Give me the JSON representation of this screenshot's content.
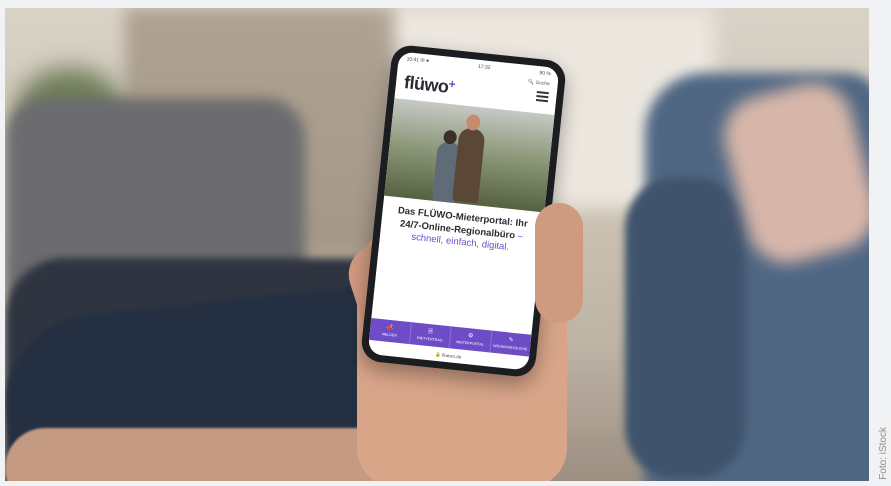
{
  "phone": {
    "status_left": "10:41 ✉ ♥",
    "status_time": "17:32",
    "status_right": "90 %",
    "search_label": "Suche",
    "logo_text": "flüwo",
    "headline_bold": "Das FLÜWO-Mieterportal: Ihr 24/7-Online-Regionalbüro",
    "headline_light": " – schnell, einfach, digital.",
    "nav": [
      {
        "icon": "megaphone-icon",
        "glyph": "📣",
        "label": "MELDEN"
      },
      {
        "icon": "document-icon",
        "glyph": "🗎",
        "label": "MIETVERTRAG"
      },
      {
        "icon": "gear-icon",
        "glyph": "⚙",
        "label": "MIETERPORTAL"
      },
      {
        "icon": "pen-icon",
        "glyph": "✎",
        "label": "WOHNUNGSSUCHE"
      }
    ],
    "url": "🔒 fluewo.de"
  },
  "credit": "Foto: iStock",
  "colors": {
    "brand": "#6f4cc7"
  }
}
